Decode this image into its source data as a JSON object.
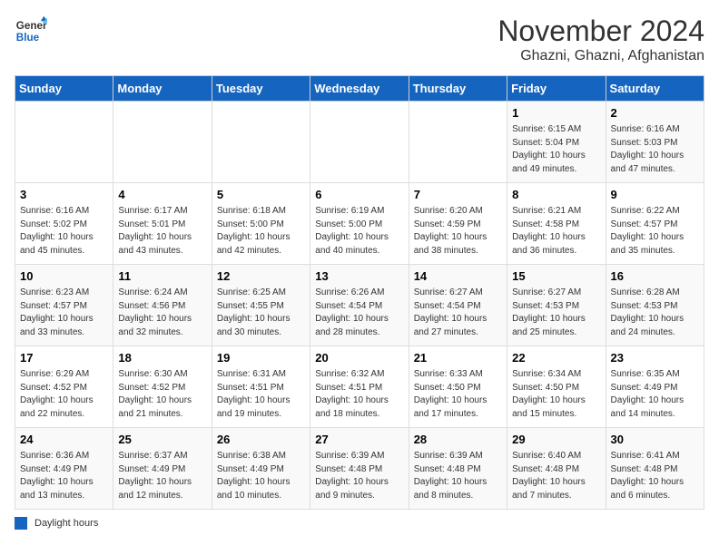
{
  "header": {
    "logo_line1": "General",
    "logo_line2": "Blue",
    "month": "November 2024",
    "location": "Ghazni, Ghazni, Afghanistan"
  },
  "days_of_week": [
    "Sunday",
    "Monday",
    "Tuesday",
    "Wednesday",
    "Thursday",
    "Friday",
    "Saturday"
  ],
  "legend_label": "Daylight hours",
  "weeks": [
    [
      {
        "num": "",
        "info": ""
      },
      {
        "num": "",
        "info": ""
      },
      {
        "num": "",
        "info": ""
      },
      {
        "num": "",
        "info": ""
      },
      {
        "num": "",
        "info": ""
      },
      {
        "num": "1",
        "info": "Sunrise: 6:15 AM\nSunset: 5:04 PM\nDaylight: 10 hours and 49 minutes."
      },
      {
        "num": "2",
        "info": "Sunrise: 6:16 AM\nSunset: 5:03 PM\nDaylight: 10 hours and 47 minutes."
      }
    ],
    [
      {
        "num": "3",
        "info": "Sunrise: 6:16 AM\nSunset: 5:02 PM\nDaylight: 10 hours and 45 minutes."
      },
      {
        "num": "4",
        "info": "Sunrise: 6:17 AM\nSunset: 5:01 PM\nDaylight: 10 hours and 43 minutes."
      },
      {
        "num": "5",
        "info": "Sunrise: 6:18 AM\nSunset: 5:00 PM\nDaylight: 10 hours and 42 minutes."
      },
      {
        "num": "6",
        "info": "Sunrise: 6:19 AM\nSunset: 5:00 PM\nDaylight: 10 hours and 40 minutes."
      },
      {
        "num": "7",
        "info": "Sunrise: 6:20 AM\nSunset: 4:59 PM\nDaylight: 10 hours and 38 minutes."
      },
      {
        "num": "8",
        "info": "Sunrise: 6:21 AM\nSunset: 4:58 PM\nDaylight: 10 hours and 36 minutes."
      },
      {
        "num": "9",
        "info": "Sunrise: 6:22 AM\nSunset: 4:57 PM\nDaylight: 10 hours and 35 minutes."
      }
    ],
    [
      {
        "num": "10",
        "info": "Sunrise: 6:23 AM\nSunset: 4:57 PM\nDaylight: 10 hours and 33 minutes."
      },
      {
        "num": "11",
        "info": "Sunrise: 6:24 AM\nSunset: 4:56 PM\nDaylight: 10 hours and 32 minutes."
      },
      {
        "num": "12",
        "info": "Sunrise: 6:25 AM\nSunset: 4:55 PM\nDaylight: 10 hours and 30 minutes."
      },
      {
        "num": "13",
        "info": "Sunrise: 6:26 AM\nSunset: 4:54 PM\nDaylight: 10 hours and 28 minutes."
      },
      {
        "num": "14",
        "info": "Sunrise: 6:27 AM\nSunset: 4:54 PM\nDaylight: 10 hours and 27 minutes."
      },
      {
        "num": "15",
        "info": "Sunrise: 6:27 AM\nSunset: 4:53 PM\nDaylight: 10 hours and 25 minutes."
      },
      {
        "num": "16",
        "info": "Sunrise: 6:28 AM\nSunset: 4:53 PM\nDaylight: 10 hours and 24 minutes."
      }
    ],
    [
      {
        "num": "17",
        "info": "Sunrise: 6:29 AM\nSunset: 4:52 PM\nDaylight: 10 hours and 22 minutes."
      },
      {
        "num": "18",
        "info": "Sunrise: 6:30 AM\nSunset: 4:52 PM\nDaylight: 10 hours and 21 minutes."
      },
      {
        "num": "19",
        "info": "Sunrise: 6:31 AM\nSunset: 4:51 PM\nDaylight: 10 hours and 19 minutes."
      },
      {
        "num": "20",
        "info": "Sunrise: 6:32 AM\nSunset: 4:51 PM\nDaylight: 10 hours and 18 minutes."
      },
      {
        "num": "21",
        "info": "Sunrise: 6:33 AM\nSunset: 4:50 PM\nDaylight: 10 hours and 17 minutes."
      },
      {
        "num": "22",
        "info": "Sunrise: 6:34 AM\nSunset: 4:50 PM\nDaylight: 10 hours and 15 minutes."
      },
      {
        "num": "23",
        "info": "Sunrise: 6:35 AM\nSunset: 4:49 PM\nDaylight: 10 hours and 14 minutes."
      }
    ],
    [
      {
        "num": "24",
        "info": "Sunrise: 6:36 AM\nSunset: 4:49 PM\nDaylight: 10 hours and 13 minutes."
      },
      {
        "num": "25",
        "info": "Sunrise: 6:37 AM\nSunset: 4:49 PM\nDaylight: 10 hours and 12 minutes."
      },
      {
        "num": "26",
        "info": "Sunrise: 6:38 AM\nSunset: 4:49 PM\nDaylight: 10 hours and 10 minutes."
      },
      {
        "num": "27",
        "info": "Sunrise: 6:39 AM\nSunset: 4:48 PM\nDaylight: 10 hours and 9 minutes."
      },
      {
        "num": "28",
        "info": "Sunrise: 6:39 AM\nSunset: 4:48 PM\nDaylight: 10 hours and 8 minutes."
      },
      {
        "num": "29",
        "info": "Sunrise: 6:40 AM\nSunset: 4:48 PM\nDaylight: 10 hours and 7 minutes."
      },
      {
        "num": "30",
        "info": "Sunrise: 6:41 AM\nSunset: 4:48 PM\nDaylight: 10 hours and 6 minutes."
      }
    ]
  ]
}
